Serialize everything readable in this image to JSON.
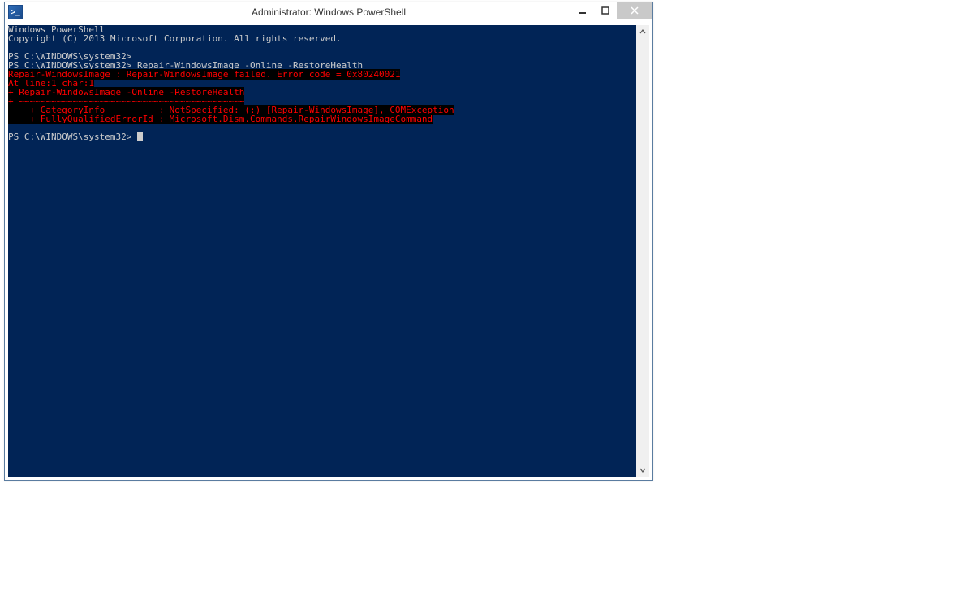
{
  "window": {
    "title": "Administrator: Windows PowerShell",
    "icon_glyph": ">_"
  },
  "console": {
    "lines": [
      {
        "type": "plain",
        "text": "Windows PowerShell"
      },
      {
        "type": "plain",
        "text": "Copyright (C) 2013 Microsoft Corporation. All rights reserved."
      },
      {
        "type": "blank",
        "text": ""
      },
      {
        "type": "prompt",
        "prompt": "PS C:\\WINDOWS\\system32>",
        "cmd": ""
      },
      {
        "type": "prompt",
        "prompt": "PS C:\\WINDOWS\\system32>",
        "cmd": " Repair-WindowsImage -Online -RestoreHealth"
      },
      {
        "type": "error",
        "text": "Repair-WindowsImage : Repair-WindowsImage failed. Error code = 0x80240021"
      },
      {
        "type": "error",
        "text": "At line:1 char:1"
      },
      {
        "type": "error",
        "text": "+ Repair-WindowsImage -Online -RestoreHealth"
      },
      {
        "type": "error",
        "text": "+ ~~~~~~~~~~~~~~~~~~~~~~~~~~~~~~~~~~~~~~~~~~"
      },
      {
        "type": "error",
        "text": "    + CategoryInfo          : NotSpecified: (:) [Repair-WindowsImage], COMException"
      },
      {
        "type": "error",
        "text": "    + FullyQualifiedErrorId : Microsoft.Dism.Commands.RepairWindowsImageCommand"
      },
      {
        "type": "blank",
        "text": " "
      },
      {
        "type": "prompt_cursor",
        "prompt": "PS C:\\WINDOWS\\system32>",
        "cmd": " "
      }
    ]
  }
}
